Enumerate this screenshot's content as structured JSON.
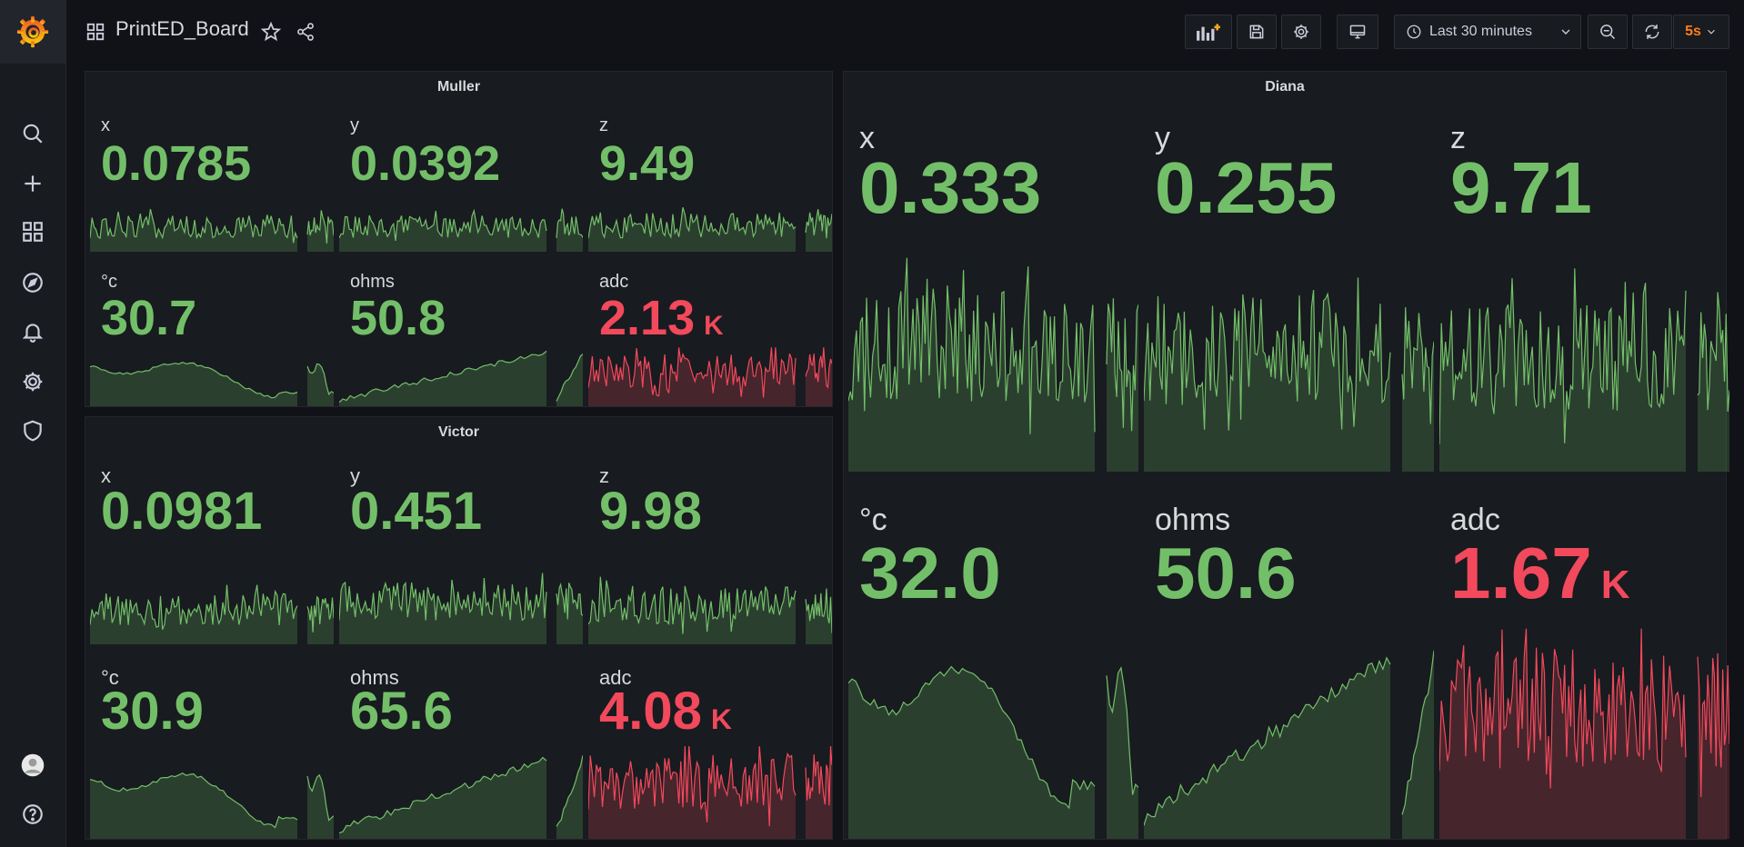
{
  "app": {
    "title": "PrintED_Board"
  },
  "sidebar": {
    "items": [
      {
        "name": "search-icon"
      },
      {
        "name": "plus-icon"
      },
      {
        "name": "dashboards-icon"
      },
      {
        "name": "compass-icon"
      },
      {
        "name": "bell-icon"
      },
      {
        "name": "gear-icon"
      },
      {
        "name": "shield-icon"
      }
    ],
    "bottom": [
      {
        "name": "avatar"
      },
      {
        "name": "help-icon"
      }
    ]
  },
  "toolbar": {
    "time_range": "Last 30 minutes",
    "refresh": "5s"
  },
  "colors": {
    "green": "#73bf69",
    "red": "#f2495c",
    "bg": "#111217",
    "panel": "#181b1f",
    "refresh": "#ff7d1a"
  },
  "panels": {
    "muller": {
      "title": "Muller",
      "stats": [
        {
          "label": "x",
          "value": "0.0785",
          "unit": "",
          "status": "ok"
        },
        {
          "label": "y",
          "value": "0.0392",
          "unit": "",
          "status": "ok"
        },
        {
          "label": "z",
          "value": "9.49",
          "unit": "",
          "status": "ok"
        },
        {
          "label": "°c",
          "value": "30.7",
          "unit": "",
          "status": "ok"
        },
        {
          "label": "ohms",
          "value": "50.8",
          "unit": "",
          "status": "ok"
        },
        {
          "label": "adc",
          "value": "2.13",
          "unit": "K",
          "status": "alert"
        }
      ]
    },
    "victor": {
      "title": "Victor",
      "stats": [
        {
          "label": "x",
          "value": "0.0981",
          "unit": "",
          "status": "ok"
        },
        {
          "label": "y",
          "value": "0.451",
          "unit": "",
          "status": "ok"
        },
        {
          "label": "z",
          "value": "9.98",
          "unit": "",
          "status": "ok"
        },
        {
          "label": "°c",
          "value": "30.9",
          "unit": "",
          "status": "ok"
        },
        {
          "label": "ohms",
          "value": "65.6",
          "unit": "",
          "status": "ok"
        },
        {
          "label": "adc",
          "value": "4.08",
          "unit": "K",
          "status": "alert"
        }
      ]
    },
    "diana": {
      "title": "Diana",
      "stats": [
        {
          "label": "x",
          "value": "0.333",
          "unit": "",
          "status": "ok"
        },
        {
          "label": "y",
          "value": "0.255",
          "unit": "",
          "status": "ok"
        },
        {
          "label": "z",
          "value": "9.71",
          "unit": "",
          "status": "ok"
        },
        {
          "label": "°c",
          "value": "32.0",
          "unit": "",
          "status": "ok"
        },
        {
          "label": "ohms",
          "value": "50.6",
          "unit": "",
          "status": "ok"
        },
        {
          "label": "adc",
          "value": "1.67",
          "unit": "K",
          "status": "alert"
        }
      ]
    }
  }
}
